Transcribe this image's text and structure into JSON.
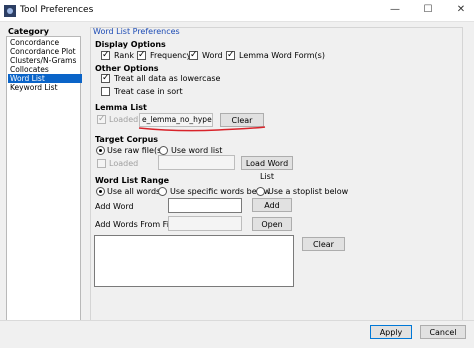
{
  "window": {
    "title": "Tool Preferences",
    "minimize": "—",
    "maximize": "☐",
    "close": "✕"
  },
  "sidebar": {
    "heading": "Category",
    "items": [
      {
        "label": "Concordance"
      },
      {
        "label": "Concordance Plot"
      },
      {
        "label": "Clusters/N-Grams"
      },
      {
        "label": "Collocates"
      },
      {
        "label": "Word List",
        "selected": true
      },
      {
        "label": "Keyword List"
      }
    ]
  },
  "panel": {
    "title": "Word List Preferences",
    "display_options": {
      "heading": "Display Options",
      "rank": "Rank",
      "frequency": "Frequency",
      "word": "Word",
      "lemma_forms": "Lemma Word Form(s)"
    },
    "other_options": {
      "heading": "Other Options",
      "lowercase": "Treat all data as lowercase",
      "case_sort": "Treat case in sort"
    },
    "lemma_list": {
      "heading": "Lemma List",
      "loaded_label": "Loaded",
      "file_value": "e_lemma_no_hypen.txt",
      "clear_button": "Clear"
    },
    "target_corpus": {
      "heading": "Target Corpus",
      "raw_files": "Use raw file(s)",
      "word_list": "Use word list",
      "loaded_label": "Loaded",
      "load_button": "Load Word List"
    },
    "word_list_range": {
      "heading": "Word List Range",
      "all_words": "Use all words",
      "specific_words": "Use specific words below",
      "stoplist": "Use a stoplist below",
      "add_word_label": "Add Word",
      "add_button": "Add",
      "add_from_file_label": "Add Words From File",
      "open_button": "Open",
      "clear_button": "Clear"
    }
  },
  "footer": {
    "apply": "Apply",
    "cancel": "Cancel"
  },
  "colors": {
    "selection": "#0a64c8",
    "annotation": "#d8232a",
    "panel_title": "#1c4bb5"
  }
}
